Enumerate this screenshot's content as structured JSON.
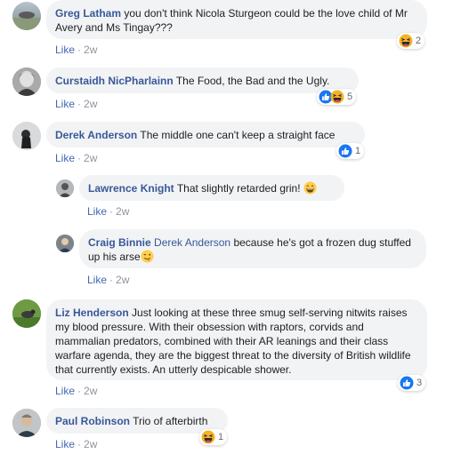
{
  "comments": [
    {
      "author": "Greg Latham",
      "text": "you don't think Nicola Sturgeon could be the love child of Mr Avery and Ms Tingay???",
      "like": "Like",
      "time": "2w",
      "reactions": {
        "icons": [
          "haha-icon"
        ],
        "count": "2"
      }
    },
    {
      "author": "Curstaidh NicPharlainn",
      "text": "The Food, the Bad and the Ugly.",
      "like": "Like",
      "time": "2w",
      "reactions": {
        "icons": [
          "like-icon",
          "haha-icon"
        ],
        "count": "5"
      }
    },
    {
      "author": "Derek Anderson",
      "text": "The middle one can't keep a straight face",
      "like": "Like",
      "time": "2w",
      "reactions": {
        "icons": [
          "like-icon"
        ],
        "count": "1"
      }
    },
    {
      "author": "Lawrence Knight",
      "text": "That slightly retarded grin!",
      "like": "Like",
      "time": "2w",
      "emoji": "laughing-emoji"
    },
    {
      "author": "Craig Binnie",
      "mention": "Derek Anderson",
      "text": "because he's got a frozen dug stuffed up his arse",
      "like": "Like",
      "time": "2w",
      "emoji": "winking-tongue-emoji"
    },
    {
      "author": "Liz Henderson",
      "text": "Just looking at these three smug self-serving nitwits raises my blood pressure. With their obsession with raptors, corvids and mammalian predators, combined with their AR leanings and their class warfare agenda, they are the biggest threat to the diversity of British wildlife that currently exists. An utterly despicable shower.",
      "like": "Like",
      "time": "2w",
      "reactions": {
        "icons": [
          "like-icon"
        ],
        "count": "3"
      }
    },
    {
      "author": "Paul Robinson",
      "text": "Trio of afterbirth",
      "like": "Like",
      "time": "2w",
      "reactions": {
        "icons": [
          "haha-icon"
        ],
        "count": "1"
      }
    }
  ],
  "separator": "·",
  "colors": {
    "link": "#385898",
    "like_blue": "#4267b2",
    "bubble": "#f2f3f5",
    "meta": "#90949c",
    "haha": "#f7b125"
  }
}
